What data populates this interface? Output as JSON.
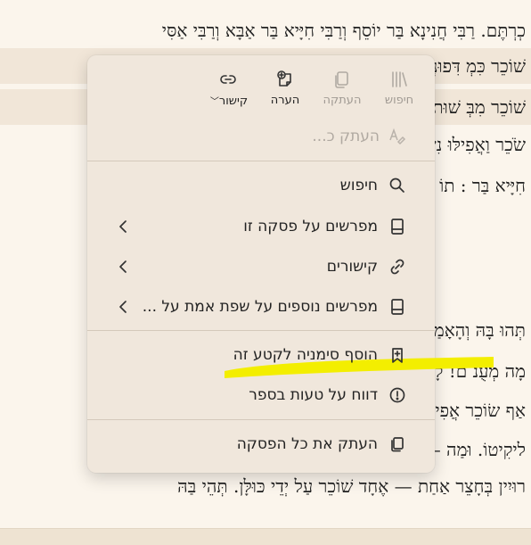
{
  "background": {
    "lines": [
      "כְרְתֶּם. רַבִּי חֲנִינָא בַּר יוֹסֵף וְרַבִּי חִיָּיא בַּר אַבָּא וְרַבִּי אַסִּי",
      "שׁוֹכֵר כִּמְ דִּפוּנְדָּק",
      "שׁוֹכֵר מִבְּ שׁוּת דָּמֵי,",
      "שֹׂכֵר וַאֲפִילּוּ נִשְׂכּוֹר, וְרַ",
      "חִיָּיא בַּר : תוֹ שֶׁיַּלּוּ",
      "",
      "",
      "",
      "תְּהוּ בָּהּ וְהָאָמַר .",
      "מָה מְעֻנ ם! לָא, מָ",
      "אַף שׂוֹכֵר אֲפִילּוּ שָׁ",
      "ליקִיטוֹ. וּמַה – אֶחָד מִנְ",
      "רוּיִין בְּחָצֵר אַחַת — אֶחָד שׁוֹכֵר עַל יְדֵי כּוּלָּן. תְּהֵי בַּהּ"
    ]
  },
  "menu": {
    "toolbar": [
      {
        "label": "חיפוש",
        "icon": "library-icon",
        "disabled": true
      },
      {
        "label": "העתקה",
        "icon": "copy-icon",
        "disabled": true
      },
      {
        "label": "הערה",
        "icon": "note-add-icon",
        "disabled": false
      },
      {
        "label": "קישור",
        "icon": "link-icon",
        "disabled": false,
        "has_dropdown": true
      }
    ],
    "copy_placeholder": "העתק כ...",
    "items": [
      {
        "label": "חיפוש",
        "icon": "search-icon",
        "submenu": false
      },
      {
        "label": "מפרשים על פסקה זו",
        "icon": "book-icon",
        "submenu": true
      },
      {
        "label": "קישורים",
        "icon": "link-icon",
        "submenu": true
      },
      {
        "label": "מפרשים נוספים על שפת אמת על ...",
        "icon": "book-icon",
        "submenu": true,
        "highlighted": true
      },
      {
        "label": "הוסף סימניה לקטע זה",
        "icon": "bookmark-add-icon",
        "submenu": false
      },
      {
        "label": "דווח על טעות בספר",
        "icon": "alert-icon",
        "submenu": false
      },
      {
        "label": "העתק את כל הפסקה",
        "icon": "copy-icon",
        "submenu": false
      }
    ],
    "highlight_color": "#f3ee00"
  }
}
